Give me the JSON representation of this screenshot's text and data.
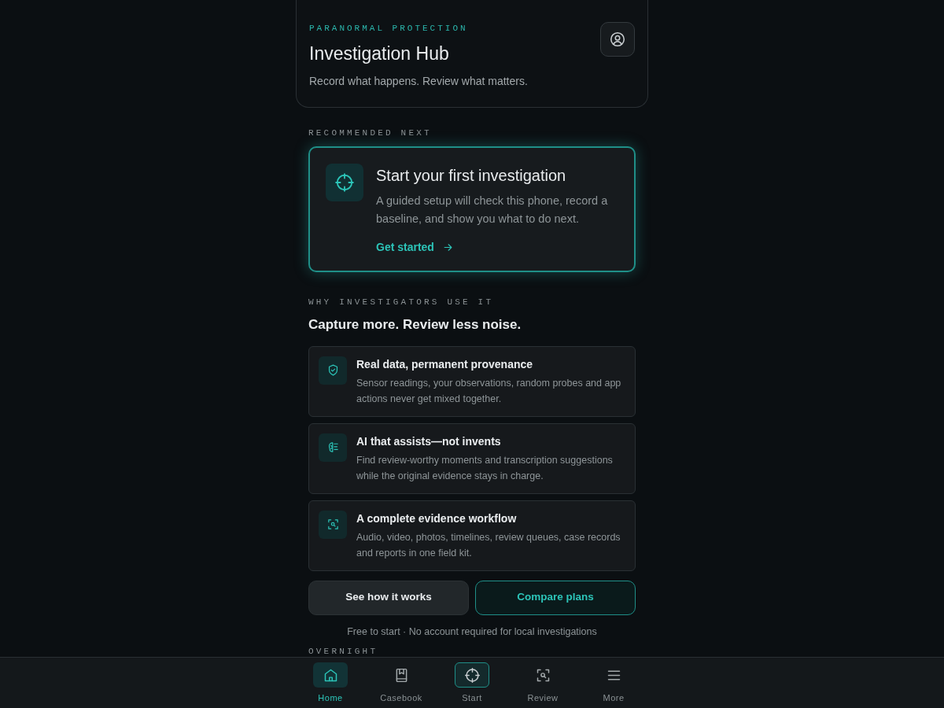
{
  "header": {
    "eyebrow": "PARANORMAL PROTECTION",
    "title": "Investigation Hub",
    "subtitle": "Record what happens. Review what matters."
  },
  "recommended": {
    "label": "RECOMMENDED NEXT",
    "title": "Start your first investigation",
    "text": "A guided setup will check this phone, record a baseline, and show you what to do next.",
    "link": "Get started"
  },
  "why": {
    "label": "WHY INVESTIGATORS USE IT",
    "heading": "Capture more. Review less noise.",
    "features": [
      {
        "title": "Real data, permanent provenance",
        "text": "Sensor readings, your observations, random probes and app actions never get mixed together."
      },
      {
        "title": "AI that assists—not invents",
        "text": "Find review-worthy moments and transcription suggestions while the original evidence stays in charge."
      },
      {
        "title": "A complete evidence workflow",
        "text": "Audio, video, photos, timelines, review queues, case records and reports in one field kit."
      }
    ]
  },
  "buttons": [
    {
      "kind": "secondary",
      "label": "See how it works"
    },
    {
      "kind": "outline",
      "label": "Compare plans"
    }
  ],
  "footnote": "Free to start · No account required for local investigations",
  "next_section": "OVERNIGHT",
  "nav": [
    {
      "label": "Home",
      "selected": true,
      "kind": "tab"
    },
    {
      "label": "Casebook",
      "selected": false,
      "kind": "tab"
    },
    {
      "label": "Start",
      "selected": false,
      "kind": "action"
    },
    {
      "label": "Review",
      "selected": false,
      "kind": "tab"
    },
    {
      "label": "More",
      "selected": false,
      "kind": "tab"
    }
  ]
}
